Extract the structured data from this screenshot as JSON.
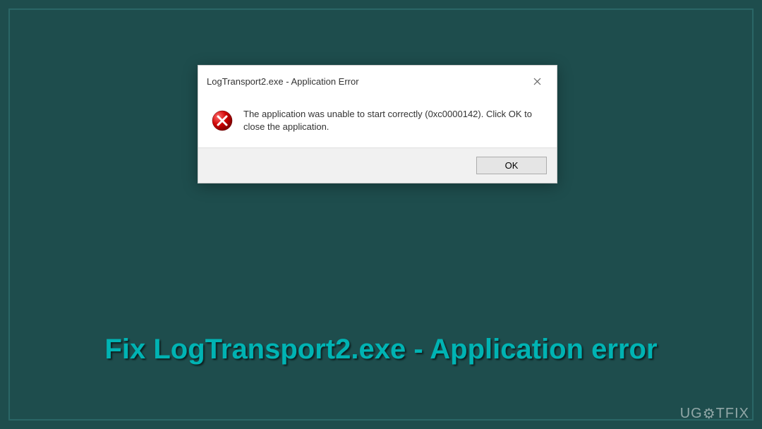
{
  "dialog": {
    "title": "LogTransport2.exe - Application Error",
    "message": "The application was unable to start correctly (0xc0000142). Click OK to close the application.",
    "ok_label": "OK"
  },
  "caption": "Fix LogTransport2.exe - Application error",
  "watermark": "UGETFIX"
}
